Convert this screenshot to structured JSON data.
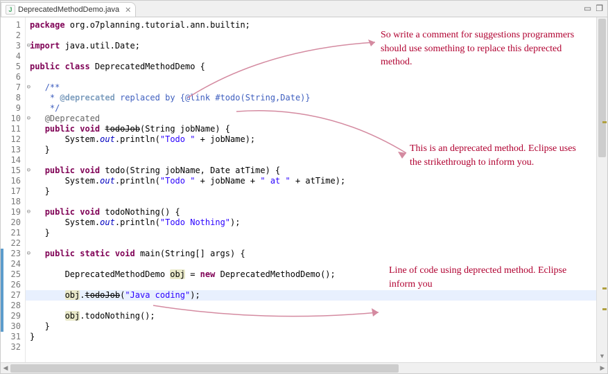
{
  "tab": {
    "filename": "DeprecatedMethodDemo.java",
    "close_glyph": "✕"
  },
  "toolbar": {
    "minimize_glyph": "▭",
    "maximize_glyph": "❐"
  },
  "code": {
    "lines": [
      {
        "n": 1,
        "t": [
          [
            "kw",
            "package"
          ],
          [
            "",
            " org.o7planning.tutorial.ann.builtin;"
          ]
        ]
      },
      {
        "n": 2,
        "t": []
      },
      {
        "n": 3,
        "fold": true,
        "t": [
          [
            "kw",
            "import"
          ],
          [
            "",
            " java.util.Date;"
          ]
        ]
      },
      {
        "n": 4,
        "t": []
      },
      {
        "n": 5,
        "t": [
          [
            "kw",
            "public class"
          ],
          [
            "",
            " DeprecatedMethodDemo {"
          ]
        ]
      },
      {
        "n": 6,
        "t": []
      },
      {
        "n": 7,
        "fold": true,
        "t": [
          [
            "",
            "   "
          ],
          [
            "cmt",
            "/**"
          ]
        ]
      },
      {
        "n": 8,
        "t": [
          [
            "",
            "   "
          ],
          [
            "cmt",
            " * "
          ],
          [
            "tag",
            "@deprecated"
          ],
          [
            "cmt",
            " replaced by "
          ],
          [
            "link",
            "{@link #todo(String,Date)}"
          ]
        ]
      },
      {
        "n": 9,
        "t": [
          [
            "",
            "   "
          ],
          [
            "cmt",
            " */"
          ]
        ]
      },
      {
        "n": 10,
        "fold": true,
        "t": [
          [
            "",
            "   "
          ],
          [
            "ann",
            "@Deprecated"
          ]
        ]
      },
      {
        "n": 11,
        "t": [
          [
            "",
            "   "
          ],
          [
            "kw",
            "public void"
          ],
          [
            "",
            " "
          ],
          [
            "strike",
            "todoJob"
          ],
          [
            "",
            "(String jobName) {"
          ]
        ]
      },
      {
        "n": 12,
        "t": [
          [
            "",
            "       System."
          ],
          [
            "fld",
            "out"
          ],
          [
            "",
            ".println("
          ],
          [
            "str",
            "\"Todo \""
          ],
          [
            "",
            " + jobName);"
          ]
        ]
      },
      {
        "n": 13,
        "t": [
          [
            "",
            "   }"
          ]
        ]
      },
      {
        "n": 14,
        "t": []
      },
      {
        "n": 15,
        "fold": true,
        "t": [
          [
            "",
            "   "
          ],
          [
            "kw",
            "public void"
          ],
          [
            "",
            " todo(String jobName, Date atTime) {"
          ]
        ]
      },
      {
        "n": 16,
        "t": [
          [
            "",
            "       System."
          ],
          [
            "fld",
            "out"
          ],
          [
            "",
            ".println("
          ],
          [
            "str",
            "\"Todo \""
          ],
          [
            "",
            " + jobName + "
          ],
          [
            "str",
            "\" at \""
          ],
          [
            "",
            " + atTime);"
          ]
        ]
      },
      {
        "n": 17,
        "t": [
          [
            "",
            "   }"
          ]
        ]
      },
      {
        "n": 18,
        "t": []
      },
      {
        "n": 19,
        "fold": true,
        "t": [
          [
            "",
            "   "
          ],
          [
            "kw",
            "public void"
          ],
          [
            "",
            " todoNothing() {"
          ]
        ]
      },
      {
        "n": 20,
        "t": [
          [
            "",
            "       System."
          ],
          [
            "fld",
            "out"
          ],
          [
            "",
            ".println("
          ],
          [
            "str",
            "\"Todo Nothing\""
          ],
          [
            "",
            ");"
          ]
        ]
      },
      {
        "n": 21,
        "t": [
          [
            "",
            "   }"
          ]
        ]
      },
      {
        "n": 22,
        "t": []
      },
      {
        "n": 23,
        "fold": true,
        "t": [
          [
            "",
            "   "
          ],
          [
            "kw",
            "public static void"
          ],
          [
            "",
            " main(String[] args) {"
          ]
        ]
      },
      {
        "n": 24,
        "t": []
      },
      {
        "n": 25,
        "t": [
          [
            "",
            "       DeprecatedMethodDemo "
          ],
          [
            "objbg",
            "obj"
          ],
          [
            "",
            " = "
          ],
          [
            "kw",
            "new"
          ],
          [
            "",
            " DeprecatedMethodDemo();"
          ]
        ]
      },
      {
        "n": 26,
        "t": []
      },
      {
        "n": 27,
        "hl": true,
        "t": [
          [
            "",
            "       "
          ],
          [
            "objbg",
            "obj"
          ],
          [
            "",
            "."
          ],
          [
            "strike",
            "todoJob"
          ],
          [
            "",
            "("
          ],
          [
            "str",
            "\"Java coding\""
          ],
          [
            "",
            ");"
          ]
        ]
      },
      {
        "n": 28,
        "t": []
      },
      {
        "n": 29,
        "t": [
          [
            "",
            "       "
          ],
          [
            "objbg",
            "obj"
          ],
          [
            "",
            ".todoNothing();"
          ]
        ]
      },
      {
        "n": 30,
        "t": [
          [
            "",
            "   }"
          ]
        ]
      },
      {
        "n": 31,
        "t": [
          [
            "",
            "}"
          ]
        ]
      },
      {
        "n": 32,
        "t": []
      }
    ],
    "marker_start": 23,
    "marker_end": 30
  },
  "annotations": {
    "a1": "So write a comment for suggestions programmers should use something to replace this deprected method.",
    "a2": "This is an deprecated method. Eclipse uses the strikethrough to inform you.",
    "a3": "Line of code using deprected method. Eclipse inform you"
  }
}
